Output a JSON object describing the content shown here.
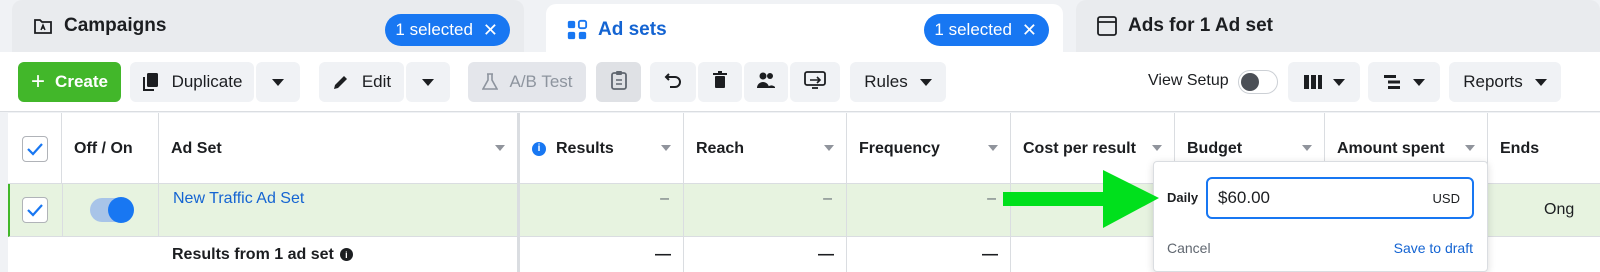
{
  "tabs": {
    "campaigns": {
      "label": "Campaigns",
      "badge": "1 selected"
    },
    "adsets": {
      "label": "Ad sets",
      "badge": "1 selected"
    },
    "ads": {
      "label": "Ads for 1 Ad set"
    }
  },
  "toolbar": {
    "create": "Create",
    "duplicate": "Duplicate",
    "edit": "Edit",
    "ab_test": "A/B Test",
    "rules": "Rules",
    "view_setup": "View Setup",
    "reports": "Reports"
  },
  "table": {
    "columns": {
      "off_on": "Off / On",
      "ad_set": "Ad Set",
      "results": "Results",
      "reach": "Reach",
      "frequency": "Frequency",
      "cost_per_result": "Cost per result",
      "budget": "Budget",
      "amount_spent": "Amount spent",
      "ends": "Ends"
    },
    "row": {
      "name": "New Traffic Ad Set",
      "results": "–",
      "reach": "–",
      "frequency": "–",
      "ends": "Ong"
    },
    "summary": {
      "label": "Results from 1 ad set",
      "results": "—",
      "reach": "—",
      "frequency": "—"
    }
  },
  "budget_popover": {
    "type_label": "Daily",
    "value": "$60.00",
    "currency": "USD",
    "cancel": "Cancel",
    "save": "Save to draft"
  },
  "colors": {
    "accent": "#1877f2",
    "create_green": "#42b72a",
    "annotation_arrow": "#00e01c",
    "selected_row": "#e7f3e0"
  }
}
